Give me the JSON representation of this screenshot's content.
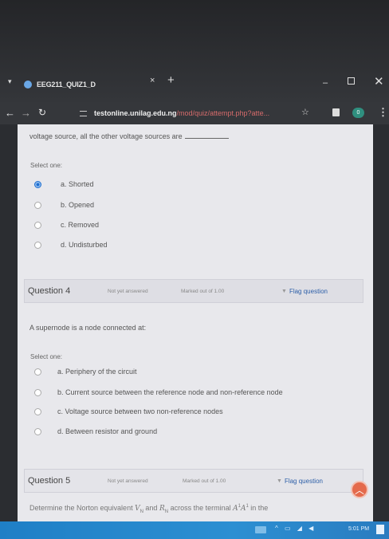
{
  "browser": {
    "tab_title": "EEG211_QUIZ1_D",
    "tab_close": "×",
    "new_tab": "+",
    "url_host": "testonline.unilag.edu.ng",
    "url_path": "/mod/quiz/attempt.php?atte...",
    "badge_count": "0"
  },
  "prev_question": {
    "text_tail": "voltage source, all the other voltage sources are",
    "select_one": "Select one:",
    "options": [
      "a. Shorted",
      "b. Opened",
      "c. Removed",
      "d. Undisturbed"
    ],
    "selected_index": 0
  },
  "question4": {
    "number": "Question 4",
    "status": "Not yet answered",
    "marks": "Marked out of 1.00",
    "flag_label": "Flag question",
    "text": "A supernode is a node connected at:",
    "select_one": "Select one:",
    "options": [
      "a. Periphery of the circuit",
      "b. Current source between the reference node and non-reference node",
      "c. Voltage source between two non-reference nodes",
      "d. Between resistor and ground"
    ]
  },
  "question5": {
    "number": "Question 5",
    "status": "Not yet answered",
    "marks": "Marked out of 1.00",
    "flag_label": "Flag question",
    "text_pre": "Determine the Norton equivalent ",
    "text_mid": " and ",
    "text_post": " across the terminal ",
    "text_end": " in the",
    "sym_v": "V",
    "sym_r": "R",
    "sub_n": "N",
    "terminal_a": "A",
    "terminal_sup": "1"
  },
  "taskbar": {
    "time": "5:01 PM"
  },
  "colors": {
    "radio_checked": "#1f6fd0",
    "flag_link": "#2d5fa8",
    "url_path": "#d66b6b",
    "scroll_button": "#e46a4c",
    "taskbar": "#1f7fc6"
  }
}
